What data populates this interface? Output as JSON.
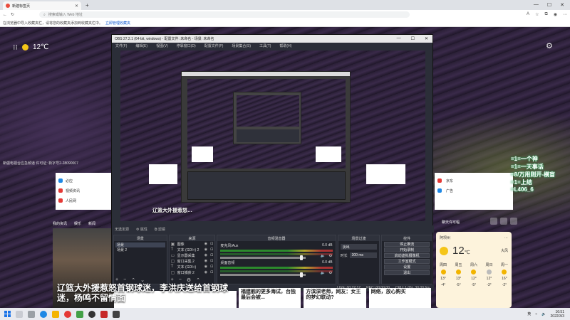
{
  "browser": {
    "tab_title": "新建标签页",
    "address_placeholder": "搜索或输入 Web 地址",
    "infobar_text": "在浏览器中导入收藏夹栏，请将您的收藏夹添加到收藏夹栏中。",
    "infobar_link": "立即管理收藏夹"
  },
  "newtab": {
    "temperature": "12",
    "unit": "℃",
    "caption": "新疆电视台应急频道 许可证: 新字号2-28090007",
    "left_card_items": [
      {
        "label": "必应",
        "color": "#1e88e5"
      },
      {
        "label": "视频资讯",
        "color": "#e53935"
      },
      {
        "label": "人民网",
        "color": "#e53935"
      }
    ],
    "feed_tabs": [
      "我的资讯",
      "娱乐",
      "新闻"
    ],
    "headline": "辽篮大外援惹怒首钢球迷，李洪庆送给首钢球迷，杨鸣不留情面",
    "news_cards": [
      "福建舰的更多海试，台独最后会被...",
      "方滨深老师，网友：女王的梦幻联动?",
      "网络，放心购买"
    ],
    "right_card_items": [
      {
        "label": "京东",
        "color": "#e53935"
      },
      {
        "label": "广告",
        "color": "#1e88e5"
      }
    ],
    "right_mini_label": "聊天许可幅"
  },
  "chat_overlay": [
    "=1=一个神",
    "=1=一天事话",
    "=8/万用则开-横盲",
    "=1=上结",
    "=L406_6"
  ],
  "weather_card": {
    "location": "阿坝州",
    "temperature": "12",
    "unit": "℃",
    "condition": "大风",
    "days": [
      {
        "name": "周四",
        "high": "13°",
        "low": "-4°"
      },
      {
        "name": "周五",
        "high": "13°",
        "low": "-5°"
      },
      {
        "name": "周六",
        "high": "12°",
        "low": "-5°"
      },
      {
        "name": "周日",
        "high": "12°",
        "low": "-3°"
      },
      {
        "name": "周一",
        "high": "16°",
        "low": "-2°"
      }
    ]
  },
  "obs": {
    "title": "OBS 27.2.1 (64-bit, windows) - 配置文件: 未命名 - 场景: 未命名",
    "menu": [
      "文件(F)",
      "编辑(E)",
      "视图(V)",
      "停靠窗口(D)",
      "配置文件(P)",
      "场景集合(S)",
      "工具(T)",
      "帮助(H)"
    ],
    "toolbar_label": "无选定源",
    "toolbar_props": "属性",
    "toolbar_filters": "滤镜",
    "scenes_header": "场景",
    "scenes": [
      "场景",
      "场景 2"
    ],
    "sources_header": "来源",
    "sources": [
      "图像",
      "文本 (GDI+) 2",
      "显示器采集",
      "窗口采集 2",
      "文本 (GDI+)",
      "窗口捕获 2"
    ],
    "mixer_header": "音频混音器",
    "mixer": [
      {
        "name": "麦克风/Aux",
        "db": "0.0 dB"
      },
      {
        "name": "桌面音频",
        "db": "0.0 dB"
      }
    ],
    "transitions_header": "场景过渡",
    "transition_type": "淡出",
    "duration_label": "时长",
    "duration_value": "300 ms",
    "controls_header": "控件",
    "controls": [
      "停止推流",
      "开始录制",
      "启动虚拟摄像机",
      "工作室模式",
      "设置",
      "退出"
    ],
    "status": [
      "LIVE: 00:22:17",
      "REC: 00:00:00",
      "CPU: 1.0%, 30.00 fps"
    ]
  },
  "taskbar": {
    "tray_lang": "英",
    "time": "16:51",
    "date": "2022/3/3"
  }
}
